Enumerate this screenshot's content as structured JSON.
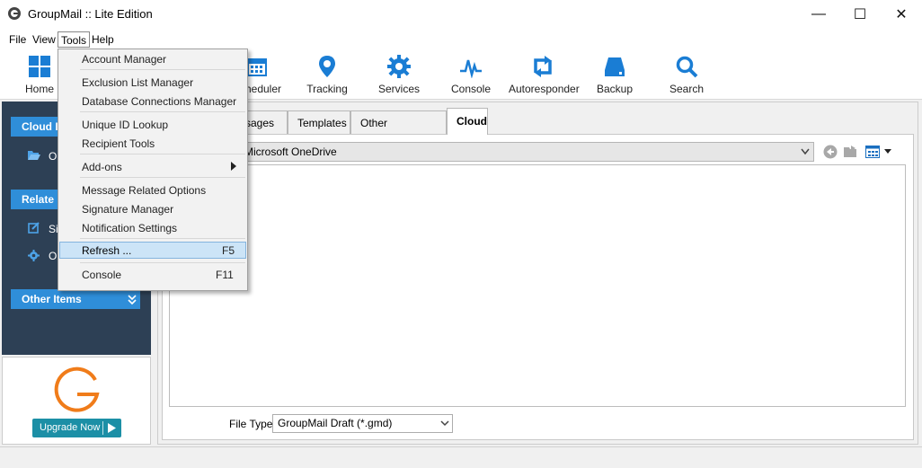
{
  "window": {
    "title": "GroupMail :: Lite Edition",
    "controls": {
      "minimize": "—",
      "maximize": "☐",
      "close": "✕"
    }
  },
  "menubar": {
    "file": "File",
    "view": "View",
    "tools": "Tools",
    "help": "Help"
  },
  "toolbar": {
    "home": "Home",
    "scheduler": "Scheduler",
    "tracking": "Tracking",
    "services": "Services",
    "console": "Console",
    "autoresponder": "Autoresponder",
    "backup": "Backup",
    "search": "Search"
  },
  "sidebar": {
    "cloud_head": "Cloud I",
    "cloud_item": "O",
    "related_head": "Relate",
    "related_item_1": "Si",
    "related_item_2": "O",
    "other_head": "Other Items",
    "upgrade": "Upgrade Now"
  },
  "tabs": {
    "messages": "ssages",
    "templates": "Templates",
    "other_docs": "Other Documents",
    "cloud": "Cloud"
  },
  "cloud": {
    "location": "Microsoft OneDrive",
    "file_type_label": "File Type:",
    "file_type_value": "GroupMail Draft (*.gmd)"
  },
  "tools_menu": {
    "account_manager": "Account Manager",
    "exclusion_list": "Exclusion List Manager",
    "db_connections": "Database Connections Manager",
    "unique_id": "Unique ID Lookup",
    "recipient_tools": "Recipient Tools",
    "addons": "Add-ons",
    "message_options": "Message Related Options",
    "signature_manager": "Signature Manager",
    "notification_settings": "Notification Settings",
    "refresh": "Refresh ...",
    "refresh_shortcut": "F5",
    "console": "Console",
    "console_shortcut": "F11"
  },
  "colors": {
    "accent": "#2f8ed9",
    "sidebar_bg": "#2d4055",
    "upgrade_btn": "#1c8fa6",
    "logo_orange": "#f07c1a"
  }
}
